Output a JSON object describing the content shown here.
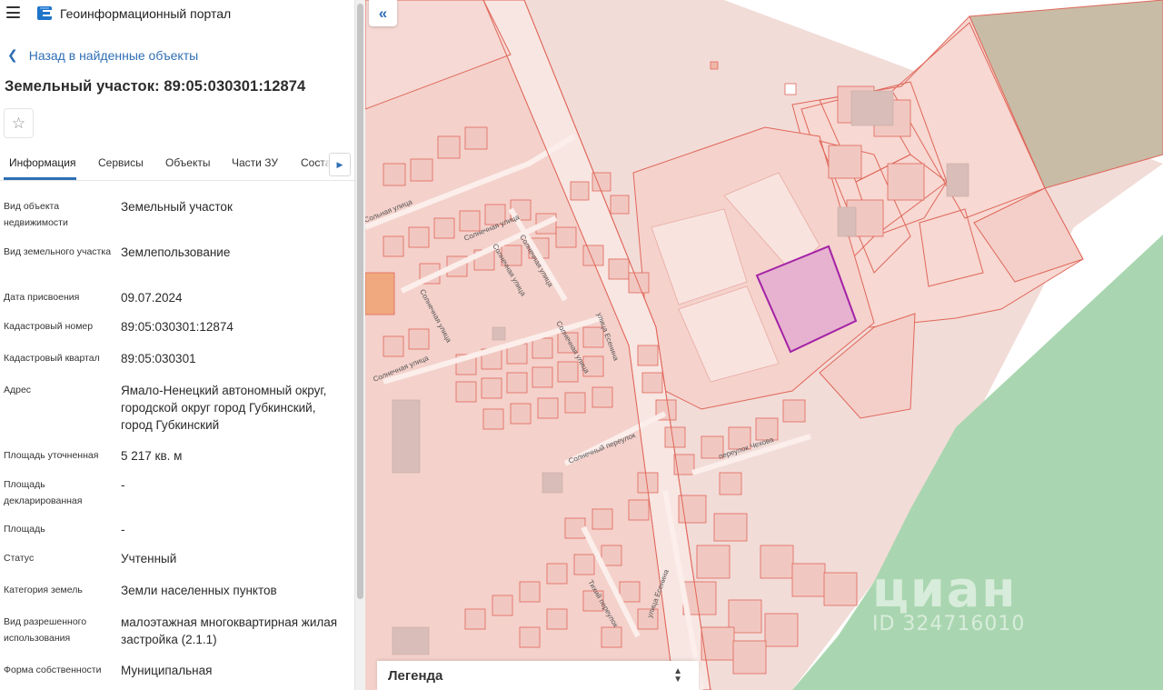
{
  "app": {
    "title": "Геоинформационный портал"
  },
  "nav": {
    "back_label": "Назад в найденные объекты"
  },
  "object": {
    "title": "Земельный участок: 89:05:030301:12874"
  },
  "tabs": [
    {
      "label": "Информация",
      "active": true
    },
    {
      "label": "Сервисы"
    },
    {
      "label": "Объекты"
    },
    {
      "label": "Части ЗУ"
    },
    {
      "label": "Соста"
    }
  ],
  "info": [
    {
      "label": "Вид объекта недвижимости",
      "value": "Земельный участок"
    },
    {
      "label": "Вид земельного участка",
      "value": "Землепользование"
    },
    {
      "label": "Дата присвоения",
      "value": "09.07.2024"
    },
    {
      "label": "Кадастровый номер",
      "value": "89:05:030301:12874"
    },
    {
      "label": "Кадастровый квартал",
      "value": "89:05:030301"
    },
    {
      "label": "Адрес",
      "value": "Ямало-Ненецкий автономный округ, городской округ город Губкинский, город Губкинский"
    },
    {
      "label": "Площадь уточненная",
      "value": "5 217 кв. м"
    },
    {
      "label": "Площадь декларированная",
      "value": "-"
    },
    {
      "label": "Площадь",
      "value": "-"
    },
    {
      "label": "Статус",
      "value": "Учтенный"
    },
    {
      "label": "Категория земель",
      "value": "Земли населенных пунктов"
    },
    {
      "label": "Вид разрешенного использования",
      "value": "малоэтажная многоквартирная жилая застройка (2.1.1)"
    },
    {
      "label": "Форма собственности",
      "value": "Муниципальная"
    }
  ],
  "map": {
    "streets": [
      "Сольная улица",
      "Солнечная улица",
      "Солнечная улица",
      "Солнечная улица",
      "Солнечная улица",
      "Солнечная улица",
      "Солнечная улица",
      "улица Есенина",
      "Солнечный переулок",
      "переулок Чехова",
      "Тихий переулок",
      "улица Есенина"
    ],
    "legend_label": "Легенда",
    "watermark_main": "циан",
    "watermark_id": "ID 324716010",
    "colors": {
      "parcel_fill": "#f4cfc9",
      "parcel_stroke": "#e0675a",
      "selected_fill": "#e6b2cf",
      "selected_stroke": "#a322a6",
      "green_area": "#a9d6b0",
      "brown_area": "#c8bca6"
    }
  }
}
